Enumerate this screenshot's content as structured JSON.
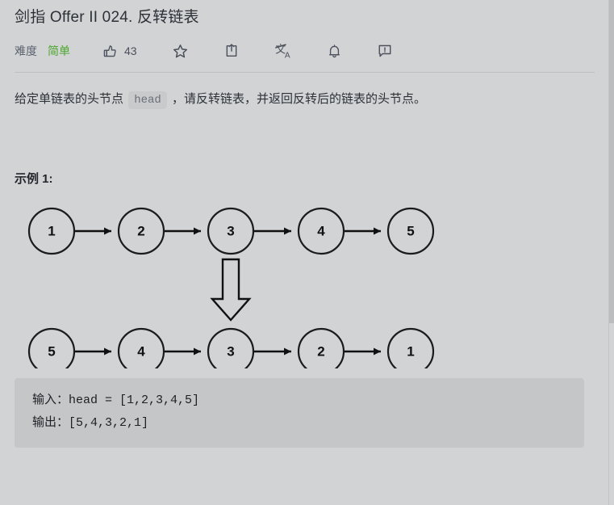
{
  "header": {
    "title": "剑指 Offer II 024. 反转链表",
    "difficulty_label": "难度",
    "difficulty_value": "简单",
    "difficulty_color": "#4ca72f",
    "like_count": "43",
    "icons": {
      "like": "thumbs-up-icon",
      "favorite": "star-icon",
      "share": "share-icon",
      "translate": "translate-icon",
      "notify": "bell-icon",
      "report": "report-icon"
    }
  },
  "description": {
    "part1": "给定单链表的头节点",
    "code": "head",
    "part2": "，请反转链表，并返回反转后的链表的头节点。"
  },
  "example": {
    "heading": "示例 1:",
    "diagram": {
      "input_list": [
        "1",
        "2",
        "3",
        "4",
        "5"
      ],
      "output_list": [
        "5",
        "4",
        "3",
        "2",
        "1"
      ],
      "transform_arrow": "down-block-arrow"
    },
    "code_block": {
      "input_line": "输入：head = [1,2,3,4,5]",
      "output_line": "输出：[5,4,3,2,1]"
    }
  },
  "colors": {
    "page_background": "#d2d3d4",
    "code_background": "#c4c6c8",
    "inline_code_background": "#c9cacc",
    "text": "#2c3138",
    "muted_text": "#5c6370",
    "divider": "#bdbfc1"
  }
}
